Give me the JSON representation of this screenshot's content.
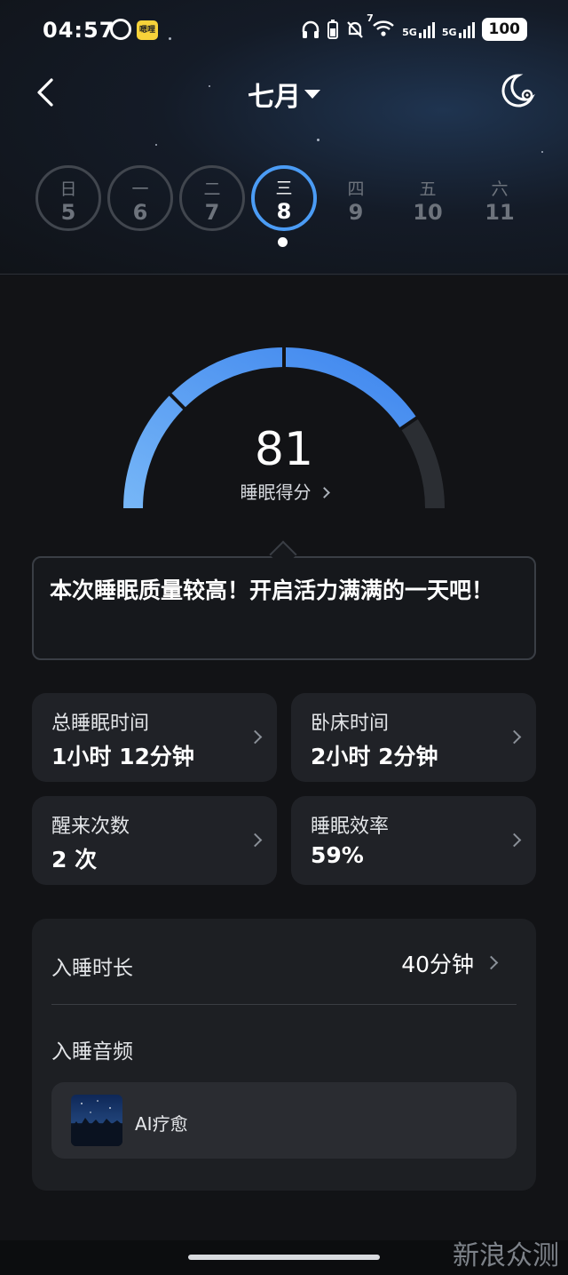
{
  "status_bar": {
    "time": "04:57",
    "app_badge": "嗯哩",
    "net_label_1": "5G",
    "net_label_2": "5G",
    "wifi_label": "7",
    "battery": "100"
  },
  "header": {
    "month": "七月"
  },
  "week": {
    "days": [
      {
        "weekday": "日",
        "date": "5"
      },
      {
        "weekday": "一",
        "date": "6"
      },
      {
        "weekday": "二",
        "date": "7"
      },
      {
        "weekday": "三",
        "date": "8"
      },
      {
        "weekday": "四",
        "date": "9"
      },
      {
        "weekday": "五",
        "date": "10"
      },
      {
        "weekday": "六",
        "date": "11"
      }
    ],
    "selected_index": 3
  },
  "score": {
    "value": "81",
    "label": "睡眠得分",
    "max": 100,
    "fill_fraction": 0.81
  },
  "message": {
    "text": "本次睡眠质量较高！开启活力满满的一天吧！"
  },
  "stats": [
    {
      "label": "总睡眠时间",
      "value": "1小时 12分钟"
    },
    {
      "label": "卧床时间",
      "value": "2小时 2分钟"
    },
    {
      "label": "醒来次数",
      "value": "2 次"
    },
    {
      "label": "睡眠效率",
      "value": "59%"
    }
  ],
  "sleep_onset": {
    "label": "入睡时长",
    "value": "40分钟"
  },
  "sleep_audio": {
    "label": "入睡音频",
    "item_name": "AI疗愈"
  },
  "watermark": "新浪众测",
  "colors": {
    "accent": "#4b9cf5",
    "gauge_start": "#6fb2f7",
    "gauge_track": "#2b2e33",
    "background": "#121316",
    "card": "#202227"
  }
}
